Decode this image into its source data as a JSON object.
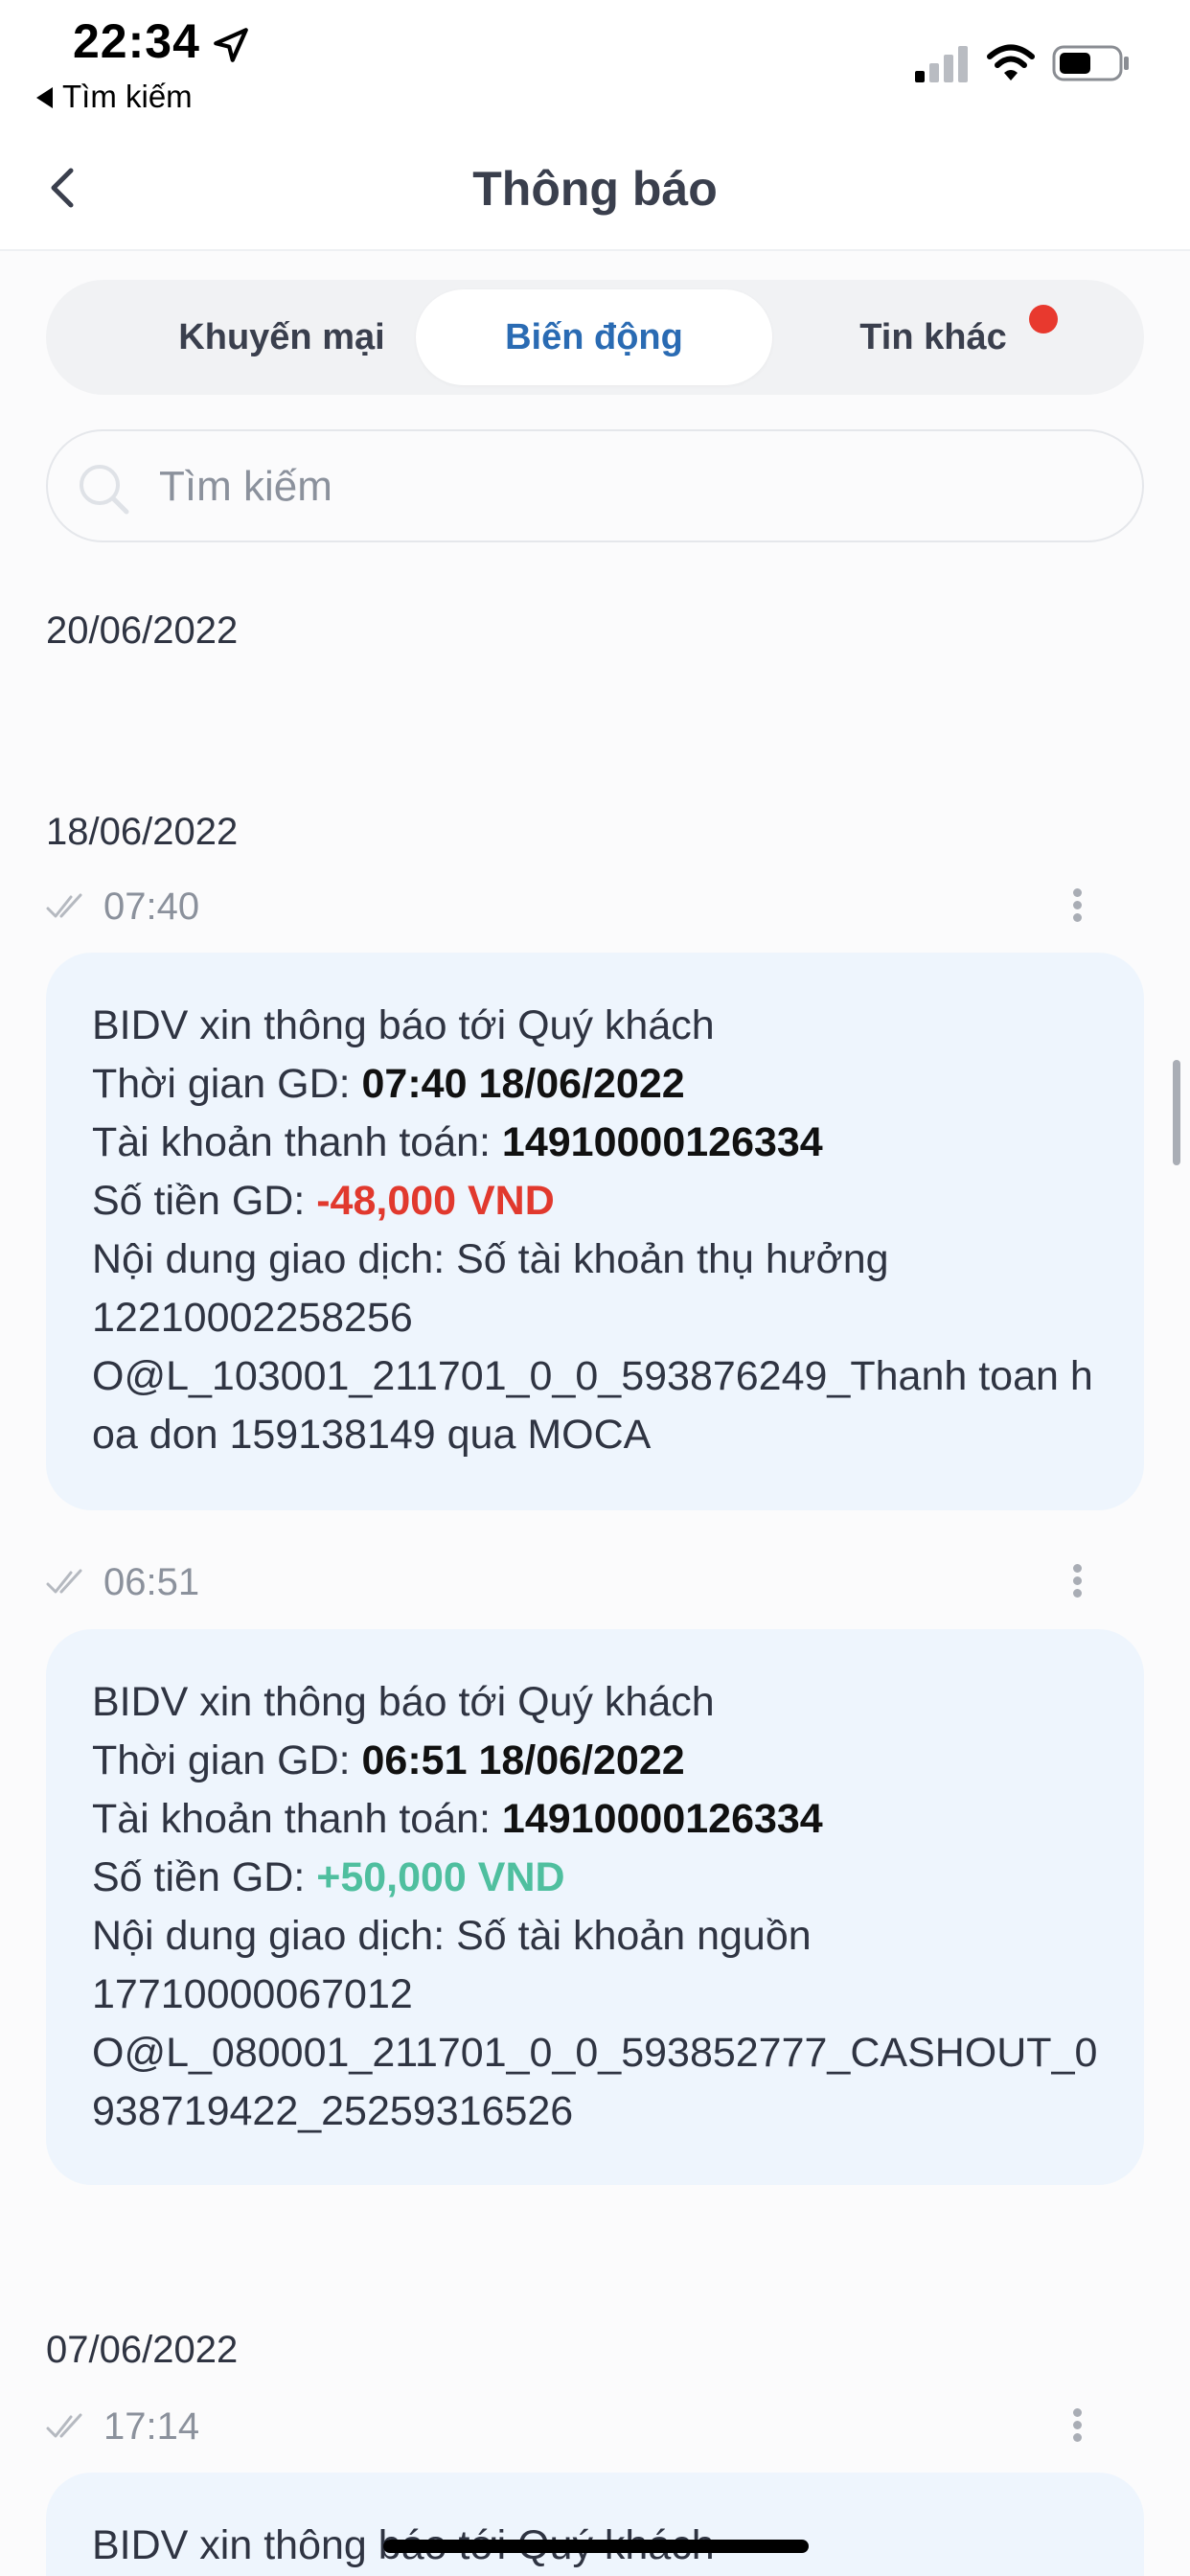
{
  "status_bar": {
    "time": "22:34",
    "back_app_label": "Tìm kiếm"
  },
  "header": {
    "title": "Thông báo"
  },
  "tabs": [
    {
      "label": "Khuyến mại",
      "active": false
    },
    {
      "label": "Biến động",
      "active": true
    },
    {
      "label": "Tin khác",
      "active": false,
      "has_badge": true
    }
  ],
  "search": {
    "placeholder": "Tìm kiếm"
  },
  "groups": [
    {
      "date": "20/06/2022"
    },
    {
      "date": "18/06/2022"
    },
    {
      "date": "07/06/2022"
    }
  ],
  "messages": [
    {
      "time": "07:40",
      "line1": "BIDV xin thông báo tới Quý khách",
      "time_label": "Thời gian GD: ",
      "time_value": "07:40 18/06/2022",
      "account_label": "Tài khoản thanh toán: ",
      "account_value": "14910000126334",
      "amount_label": "Số tiền GD: ",
      "amount_value": "-48,000 VND",
      "content_label": "Nội dung giao dịch: Số tài khoản thụ hưởng",
      "content_line2": "12210002258256",
      "content_line3": "O@L_103001_211701_0_0_593876249_Thanh toan hoa don 159138149 qua MOCA"
    },
    {
      "time": "06:51",
      "line1": "BIDV xin thông báo tới Quý khách",
      "time_label": "Thời gian GD: ",
      "time_value": "06:51 18/06/2022",
      "account_label": "Tài khoản thanh toán: ",
      "account_value": "14910000126334",
      "amount_label": "Số tiền GD: ",
      "amount_value": "+50,000 VND",
      "content_label": "Nội dung giao dịch: Số tài khoản nguồn",
      "content_line2": "17710000067012",
      "content_line3": "O@L_080001_211701_0_0_593852777_CASHOUT_0938719422_25259316526"
    },
    {
      "time": "17:14",
      "line1": "BIDV xin thông báo tới Quý khách"
    }
  ],
  "colors": {
    "accent": "#2a6bb3",
    "negative": "#e1392e",
    "positive": "#4fbf9f",
    "card_bg": "#eef5fd",
    "badge": "#e8392e"
  }
}
